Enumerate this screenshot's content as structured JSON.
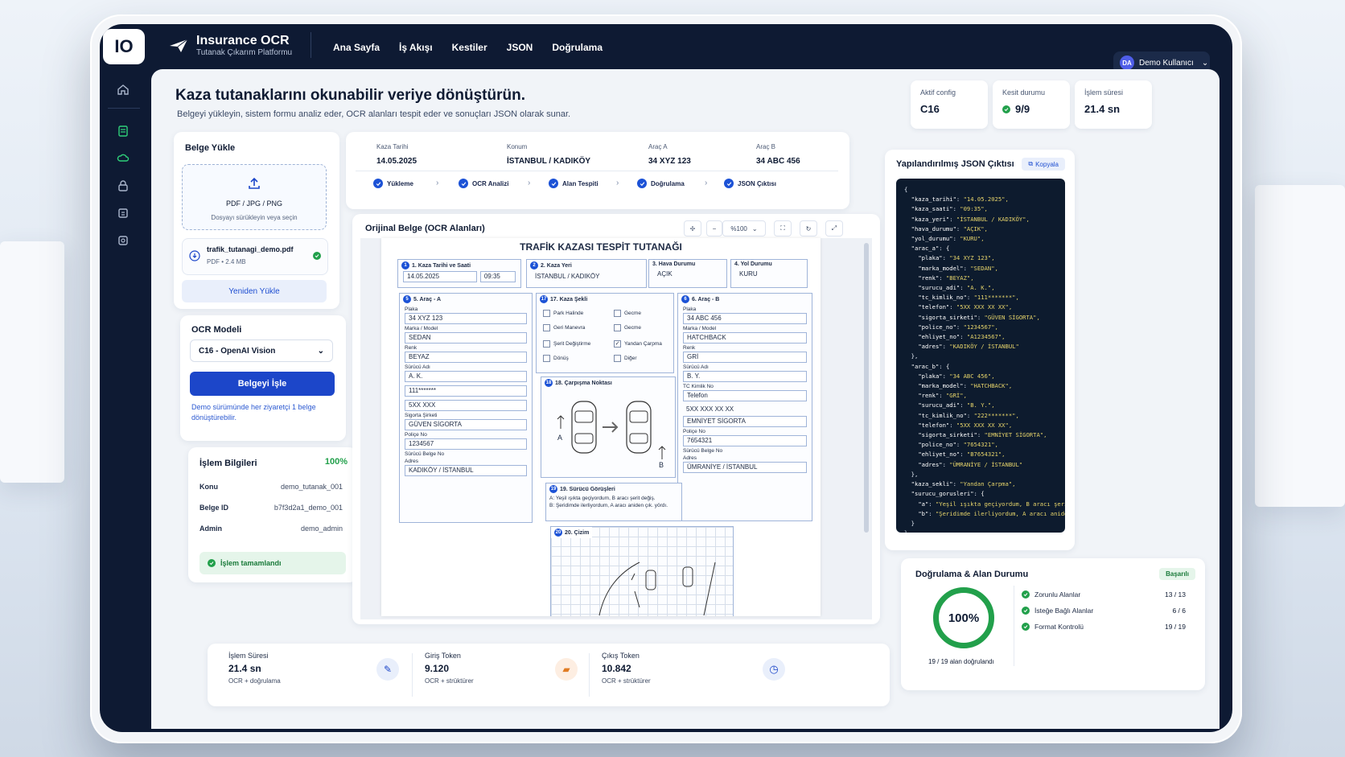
{
  "app": {
    "logo": "IO",
    "title": "Insurance OCR",
    "subtitle": "Tutanak Çıkarım Platformu"
  },
  "nav": [
    "Ana Sayfa",
    "İş Akışı",
    "Kestiler",
    "JSON",
    "Doğrulama"
  ],
  "user": {
    "initials": "DA",
    "name": "Demo Kullanıcı"
  },
  "hero": {
    "title": "Kaza tutanaklarını okunabilir veriye dönüştürün.",
    "subtitle": "Belgeyi yükleyin, sistem formu analiz eder, OCR alanları tespit eder ve sonuçları JSON olarak sunar."
  },
  "stats": [
    {
      "label": "Aktif config",
      "value": "C16"
    },
    {
      "label": "Kesit durumu",
      "value": "9/9"
    },
    {
      "label": "İşlem süresi",
      "value": "21.4 sn"
    }
  ],
  "upload": {
    "title": "Belge Yükle",
    "formats": "PDF / JPG / PNG",
    "hint": "Dosyayı sürükleyin veya seçin",
    "file_name": "trafik_tutanagi_demo.pdf",
    "file_meta": "PDF • 2.4 MB",
    "reupload": "Yeniden Yükle"
  },
  "model": {
    "title": "OCR Modeli",
    "selected": "C16 - OpenAI Vision",
    "process_btn": "Belgeyi İşle",
    "note": "Demo sürümünde her ziyaretçi 1 belge dönüştürebilir."
  },
  "info": {
    "title": "İşlem Bilgileri",
    "percent": "100%",
    "rows": [
      {
        "key": "Konu",
        "value": "demo_tutanak_001"
      },
      {
        "key": "Belge ID",
        "value": "b7f3d2a1_demo_001"
      },
      {
        "key": "Admin",
        "value": "demo_admin"
      }
    ],
    "done": "İşlem tamamlandı"
  },
  "meta": [
    {
      "label": "Kaza Tarihi",
      "value": "14.05.2025"
    },
    {
      "label": "Konum",
      "value": "İSTANBUL  /  KADIKÖY"
    },
    {
      "label": "Araç A",
      "value": "34 XYZ 123"
    },
    {
      "label": "Araç B",
      "value": "34 ABC 456"
    }
  ],
  "steps": [
    "Yükleme",
    "OCR Analizi",
    "Alan Tespiti",
    "Doğrulama",
    "JSON Çıktısı"
  ],
  "viewer": {
    "title": "Orijinal Belge (OCR Alanları)",
    "zoom": "%100"
  },
  "doc": {
    "title": "TRAFİK KAZASI TESPİT TUTANAĞI",
    "s1": {
      "label": "1. Kaza Tarihi ve Saati",
      "date": "14.05.2025",
      "time": "09:35"
    },
    "s2": {
      "label": "2. Kaza Yeri",
      "value": "İSTANBUL / KADIKÖY"
    },
    "s3": {
      "label": "3. Hava Durumu",
      "value": "AÇIK"
    },
    "s4": {
      "label": "4. Yol Durumu",
      "value": "KURU"
    },
    "a": {
      "label": "5. Araç - A",
      "fields": [
        {
          "l": "Plaka",
          "v": "34 XYZ 123"
        },
        {
          "l": "Marka / Model",
          "v": "SEDAN"
        },
        {
          "l": "Renk",
          "v": "BEYAZ"
        },
        {
          "l": "Sürücü Adı",
          "v": "A. K."
        },
        {
          "l": "",
          "v": "111*******"
        },
        {
          "l": "",
          "v": "5XX XXX"
        },
        {
          "l": "Sigorta Şirketi",
          "v": "GÜVEN SİGORTA"
        },
        {
          "l": "Poliçe No",
          "v": "1234567"
        },
        {
          "l": "Sürücü Belge No",
          "v": ""
        },
        {
          "l": "Adres",
          "v": "KADIKÖY / İSTANBUL"
        }
      ]
    },
    "b": {
      "label": "6. Araç - B",
      "fields": [
        {
          "l": "Plaka",
          "v": "34 ABC 456"
        },
        {
          "l": "Marka / Model",
          "v": "HATCHBACK"
        },
        {
          "l": "Renk",
          "v": "GRİ"
        },
        {
          "l": "Sürücü Adı",
          "v": "B. Y."
        },
        {
          "l": "TC Kimlik No",
          "v": "Telefon"
        },
        {
          "l": "",
          "v": "5XX XXX XX XX"
        },
        {
          "l": "",
          "v": "EMNİYET SİGORTA"
        },
        {
          "l": "Poliçe No",
          "v": "7654321"
        },
        {
          "l": "Sürücü Belge No",
          "v": ""
        },
        {
          "l": "Adres",
          "v": "ÜMRANİYE / İSTANBUL"
        }
      ]
    },
    "s17": {
      "label": "17. Kaza Şekli",
      "options": [
        "Park Halinde",
        "Geri Manevra",
        "Şerit Değiştirme",
        "Dönüş",
        "Gecme",
        "Yandan Çarpma",
        "Diğer",
        "Gecme"
      ],
      "checked": "Yandan Çarpma"
    },
    "s18": {
      "label": "18. Çarpışma Noktası",
      "a": "A",
      "b": "B"
    },
    "s19": {
      "label": "19. Sürücü Görüşleri",
      "a": "A: Yeşil ışıkta geçiyordum, B aracı şerit değiş.",
      "b": "B: Şeridimde ilerliyordum, A aracı aniden çık. yördı."
    },
    "s20": {
      "label": "20. Çizim"
    }
  },
  "json": {
    "title": "Yapılandırılmış JSON Çıktısı",
    "copy": "Kopyala",
    "lines": [
      "{",
      "  \"kaza_tarihi\": \"14.05.2025\",",
      "  \"kaza_saati\": \"09:35\",",
      "  \"kaza_yeri\": \"İSTANBUL / KADIKÖY\",",
      "  \"hava_durumu\": \"AÇIK\",",
      "  \"yol_durumu\": \"KURU\",",
      "  \"arac_a\": {",
      "    \"plaka\": \"34 XYZ 123\",",
      "    \"marka_model\": \"SEDAN\",",
      "    \"renk\": \"BEYAZ\",",
      "    \"surucu_adi\": \"A. K.\",",
      "    \"tc_kimlik_no\": \"111*******\",",
      "    \"telefon\": \"5XX XXX XX XX\",",
      "    \"sigorta_sirketi\": \"GÜVEN SİGORTA\",",
      "    \"police_no\": \"1234567\",",
      "    \"ehliyet_no\": \"A1234567\",",
      "    \"adres\": \"KADIKÖY / İSTANBUL\"",
      "  },",
      "  \"arac_b\": {",
      "    \"plaka\": \"34 ABC 456\",",
      "    \"marka_model\": \"HATCHBACK\",",
      "    \"renk\": \"GRİ\",",
      "    \"surucu_adi\": \"B. Y.\",",
      "    \"tc_kimlik_no\": \"222*******\",",
      "    \"telefon\": \"5XX XXX XX XX\",",
      "    \"sigorta_sirketi\": \"EMNİYET SİGORTA\",",
      "    \"police_no\": \"7654321\",",
      "    \"ehliyet_no\": \"B7654321\",",
      "    \"adres\": \"ÜMRANİYE / İSTANBUL\"",
      "  },",
      "  \"kaza_sekli\": \"Yandan Çarpma\",",
      "  \"surucu_gorusleri\": {",
      "    \"a\": \"Yeşil ışıkta geçiyordum, B aracı şerit değiştirdi.\",",
      "    \"b\": \"Şeridimde ilerliyordum, A aracı aniden çıktı.\"",
      "  }",
      "}"
    ]
  },
  "validation": {
    "title": "Doğrulama & Alan Durumu",
    "badge": "Başarılı",
    "percent": "100%",
    "caption": "19 / 19 alan doğrulandı",
    "rows": [
      {
        "name": "Zorunlu Alanlar",
        "count": "13 / 13"
      },
      {
        "name": "İsteğe Bağlı Alanlar",
        "count": "6 / 6"
      },
      {
        "name": "Format Kontrolü",
        "count": "19 / 19"
      }
    ]
  },
  "bottom": [
    {
      "label": "İşlem Süresi",
      "value": "21.4 sn",
      "sub": "OCR + doğrulama"
    },
    {
      "label": "Giriş Token",
      "value": "9.120",
      "sub": "OCR + strüktürer"
    },
    {
      "label": "Çıkış Token",
      "value": "10.842",
      "sub": "OCR + strüktürer"
    }
  ],
  "colors": {
    "accent": "#1c46c9",
    "success": "#22a04b",
    "sidebar": "#0e1a33"
  }
}
